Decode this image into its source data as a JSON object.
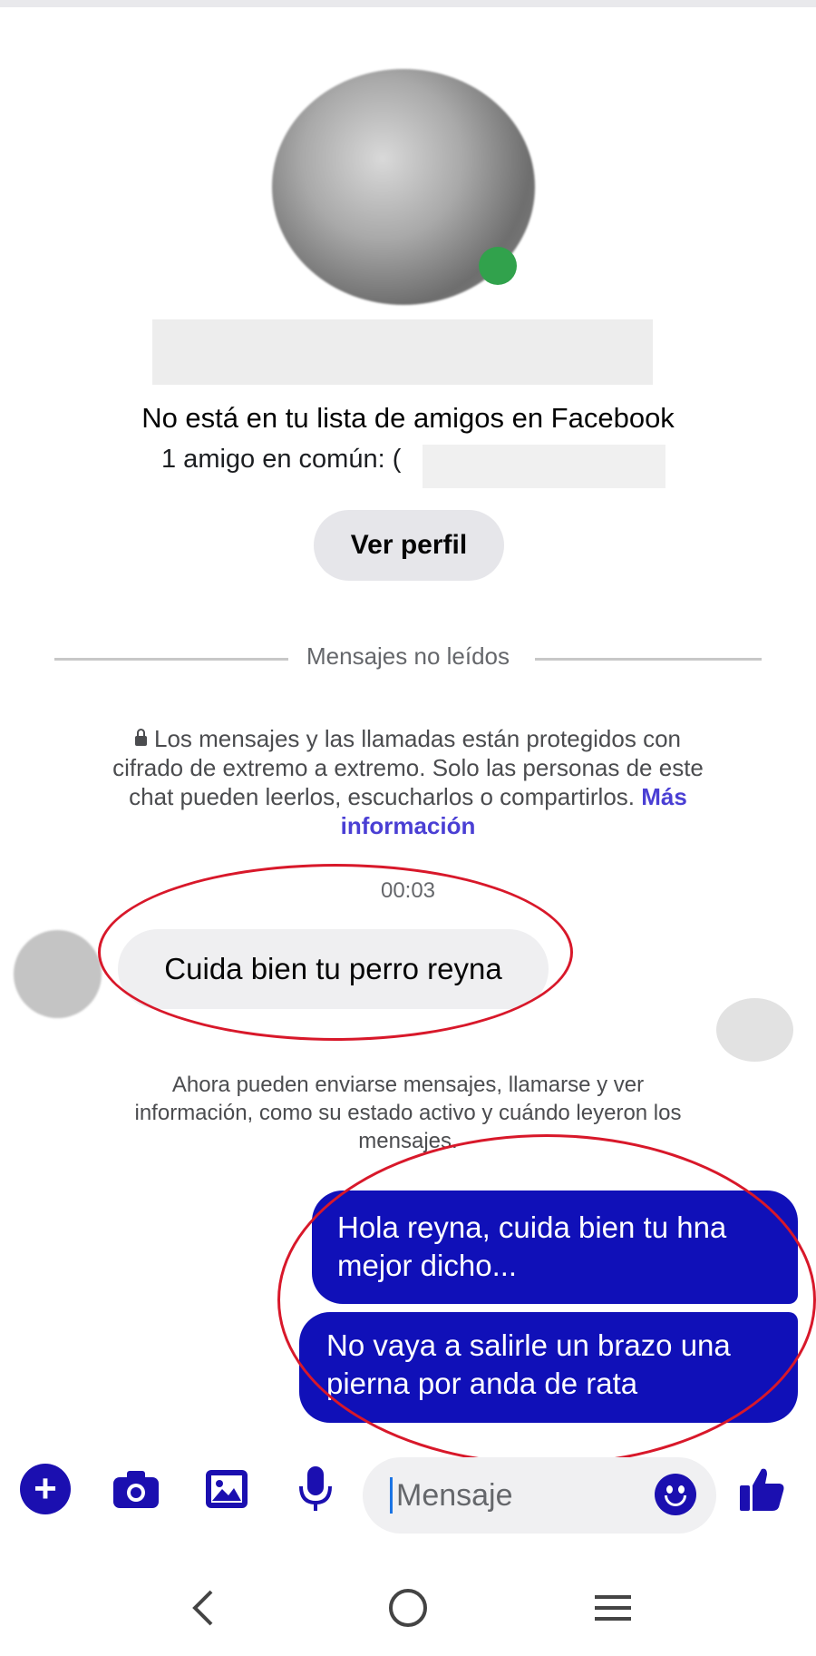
{
  "profile": {
    "not_friends_text": "No está en tu lista de amigos en Facebook",
    "mutual_friends_text": "1 amigo en común: (",
    "view_profile_label": "Ver perfil"
  },
  "divider": {
    "label": "Mensajes no leídos"
  },
  "encryption_notice": {
    "text": "Los mensajes y las llamadas están protegidos con cifrado de extremo a extremo. Solo las personas de este chat pueden leerlos, escucharlos o compartirlos.",
    "link": "Más información"
  },
  "conversation": {
    "timestamp": "00:03",
    "incoming_message": "Cuida bien tu perro reyna",
    "info_text": "Ahora pueden enviarse mensajes, llamarse y ver información, como su estado activo y cuándo leyeron los mensajes.",
    "outgoing_messages": [
      {
        "text": "Hola reyna, cuida bien tu hna mejor dicho..."
      },
      {
        "text": "No vaya a salirle un brazo una pierna por anda de rata"
      }
    ]
  },
  "composer": {
    "placeholder": "Mensaje",
    "icons": [
      "plus-icon",
      "camera-icon",
      "image-icon",
      "microphone-icon",
      "emoji-icon",
      "thumbs-up-icon"
    ]
  },
  "navigation": {
    "icons": [
      "back-icon",
      "home-icon",
      "menu-icon"
    ]
  },
  "colors": {
    "accent": "#1b0fb0",
    "outgoing_bubble": "#1010b8",
    "incoming_bubble": "#efeff1",
    "highlight": "#d8182a",
    "link": "#4a3fd4"
  }
}
